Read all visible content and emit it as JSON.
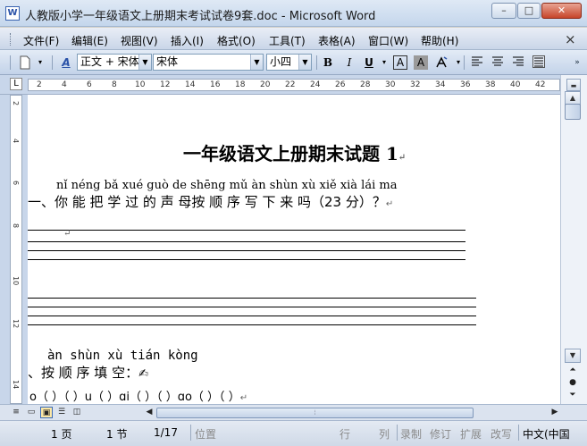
{
  "window": {
    "title": "人教版小学一年级语文上册期末考试试卷9套.doc - Microsoft Word",
    "doc_icon_letter": "W",
    "min_glyph": "–",
    "max_glyph": "□",
    "close_glyph": "✕"
  },
  "menu": {
    "items": [
      "文件(F)",
      "编辑(E)",
      "视图(V)",
      "插入(I)",
      "格式(O)",
      "工具(T)",
      "表格(A)",
      "窗口(W)",
      "帮助(H)"
    ],
    "close_glyph": "×"
  },
  "toolbar": {
    "style_value": "正文 + 宋体",
    "font_value": "宋体",
    "size_value": "小四",
    "bold_label": "B",
    "italic_label": "I",
    "underline_label": "U",
    "char_border_label": "A",
    "char_shading_label": "A",
    "styles_icon_label": "A"
  },
  "ruler": {
    "tab_selector": "L",
    "ticks": [
      "2",
      "4",
      "6",
      "8",
      "10",
      "12",
      "14",
      "16",
      "18",
      "20",
      "22",
      "24",
      "26",
      "28",
      "30",
      "32",
      "34",
      "36",
      "38",
      "40",
      "42"
    ],
    "vticks": [
      "2",
      "4",
      "6",
      "8",
      "10",
      "12",
      "14"
    ]
  },
  "document": {
    "heading": "一年级语文上册期末试题 1",
    "q1_pinyin": "nǐ néng bǎ xué guò de shēng mǔ àn shùn xù xiě xià lái ma",
    "q1_text": "一、你 能 把 学 过 的  声  母按 顺 序 写 下  来 吗（23 分）？",
    "q2_pinyin": "àn  shùn  xù  tián  kòng",
    "q2_text": "、按   顺   序   填     空：",
    "q2_line": "o（   ）（   ）u（   ）ɑi（     ）（     ）ɑo（     ）（     ）",
    "para_mark": "↵"
  },
  "statusbar": {
    "page": "1 页",
    "section": "1 节",
    "page_of": "1/17",
    "position": "位置",
    "line": "行",
    "column": "列",
    "rec": "录制",
    "trk": "修订",
    "ext": "扩展",
    "ovr": "改写",
    "language": "中文(中国"
  }
}
